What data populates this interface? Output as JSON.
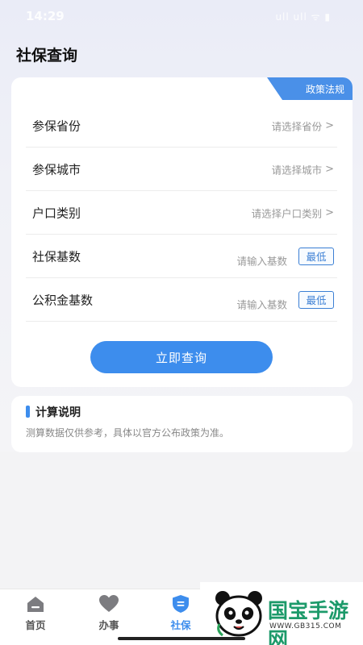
{
  "status": {
    "time": "14:29",
    "icons": "ull ull ᯤ ▮"
  },
  "page": {
    "title": "社保查询"
  },
  "ribbon": {
    "label": "政策法规"
  },
  "form": {
    "rows": [
      {
        "label": "参保省份",
        "placeholder": "请选择省份"
      },
      {
        "label": "参保城市",
        "placeholder": "请选择城市"
      },
      {
        "label": "户口类别",
        "placeholder": "请选择户口类别"
      },
      {
        "label": "社保基数",
        "placeholder": "请输入基数",
        "button": "最低"
      },
      {
        "label": "公积金基数",
        "placeholder": "请输入基数",
        "button": "最低"
      }
    ],
    "submit": "立即查询"
  },
  "info": {
    "title": "计算说明",
    "desc": "测算数据仅供参考，具体以官方公布政策为准。"
  },
  "tabs": [
    {
      "label": "首页",
      "icon": "home-icon"
    },
    {
      "label": "办事",
      "icon": "heart-icon"
    },
    {
      "label": "社保",
      "icon": "shield-icon",
      "active": true
    }
  ],
  "watermark": {
    "brand": "国宝手游网",
    "site": "WWW.GB315.COM"
  },
  "colors": {
    "accent": "#3d8ded",
    "brand_green": "#1c9a6a"
  }
}
